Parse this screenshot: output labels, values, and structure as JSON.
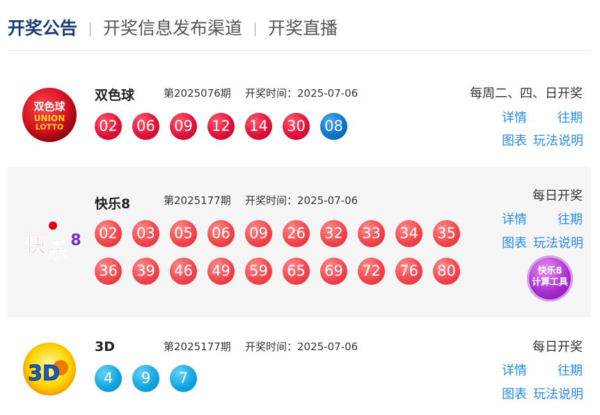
{
  "tabs": [
    {
      "label": "开奖公告"
    },
    {
      "label": "开奖信息发布渠道"
    },
    {
      "label": "开奖直播"
    }
  ],
  "lotteries": [
    {
      "name": "双色球",
      "logo_text": [
        "双色球",
        "UNION",
        "LOTTO"
      ],
      "issue": "第2025076期",
      "date_label": "开奖时间：2025-07-06",
      "schedule": "每周二、四、日开奖",
      "balls_red": [
        "02",
        "06",
        "09",
        "12",
        "14",
        "30"
      ],
      "balls_blue": [
        "08"
      ],
      "links": {
        "details": "详情",
        "history": "往期",
        "chart": "图表",
        "rules": "玩法说明"
      }
    },
    {
      "name": "快乐8",
      "logo_text": [
        "快",
        "乐",
        "8"
      ],
      "issue": "第2025177期",
      "date_label": "开奖时间：2025-07-06",
      "schedule": "每日开奖",
      "balls_row1": [
        "02",
        "03",
        "05",
        "06",
        "09",
        "26",
        "32",
        "33",
        "34",
        "35"
      ],
      "balls_row2": [
        "36",
        "39",
        "46",
        "49",
        "59",
        "65",
        "69",
        "72",
        "76",
        "80"
      ],
      "links": {
        "details": "详情",
        "history": "往期",
        "chart": "图表",
        "rules": "玩法说明"
      },
      "calculator": {
        "line1": "快乐8",
        "line2": "计算工具"
      }
    },
    {
      "name": "3D",
      "logo_text": [
        "3D"
      ],
      "issue": "第2025177期",
      "date_label": "开奖时间：2025-07-06",
      "schedule": "每日开奖",
      "balls": [
        "4",
        "9",
        "7"
      ],
      "links": {
        "details": "详情",
        "history": "往期",
        "chart": "图表",
        "rules": "玩法说明"
      }
    }
  ],
  "colors": {
    "active_tab": "#1a3f70",
    "link": "#2c8ae5",
    "red_ball": "#e0123a",
    "blue_ball": "#0b76c8",
    "coral_ball": "#f2474e",
    "cyan_ball": "#13a6e0",
    "row_highlight": "#f5f5f5"
  }
}
